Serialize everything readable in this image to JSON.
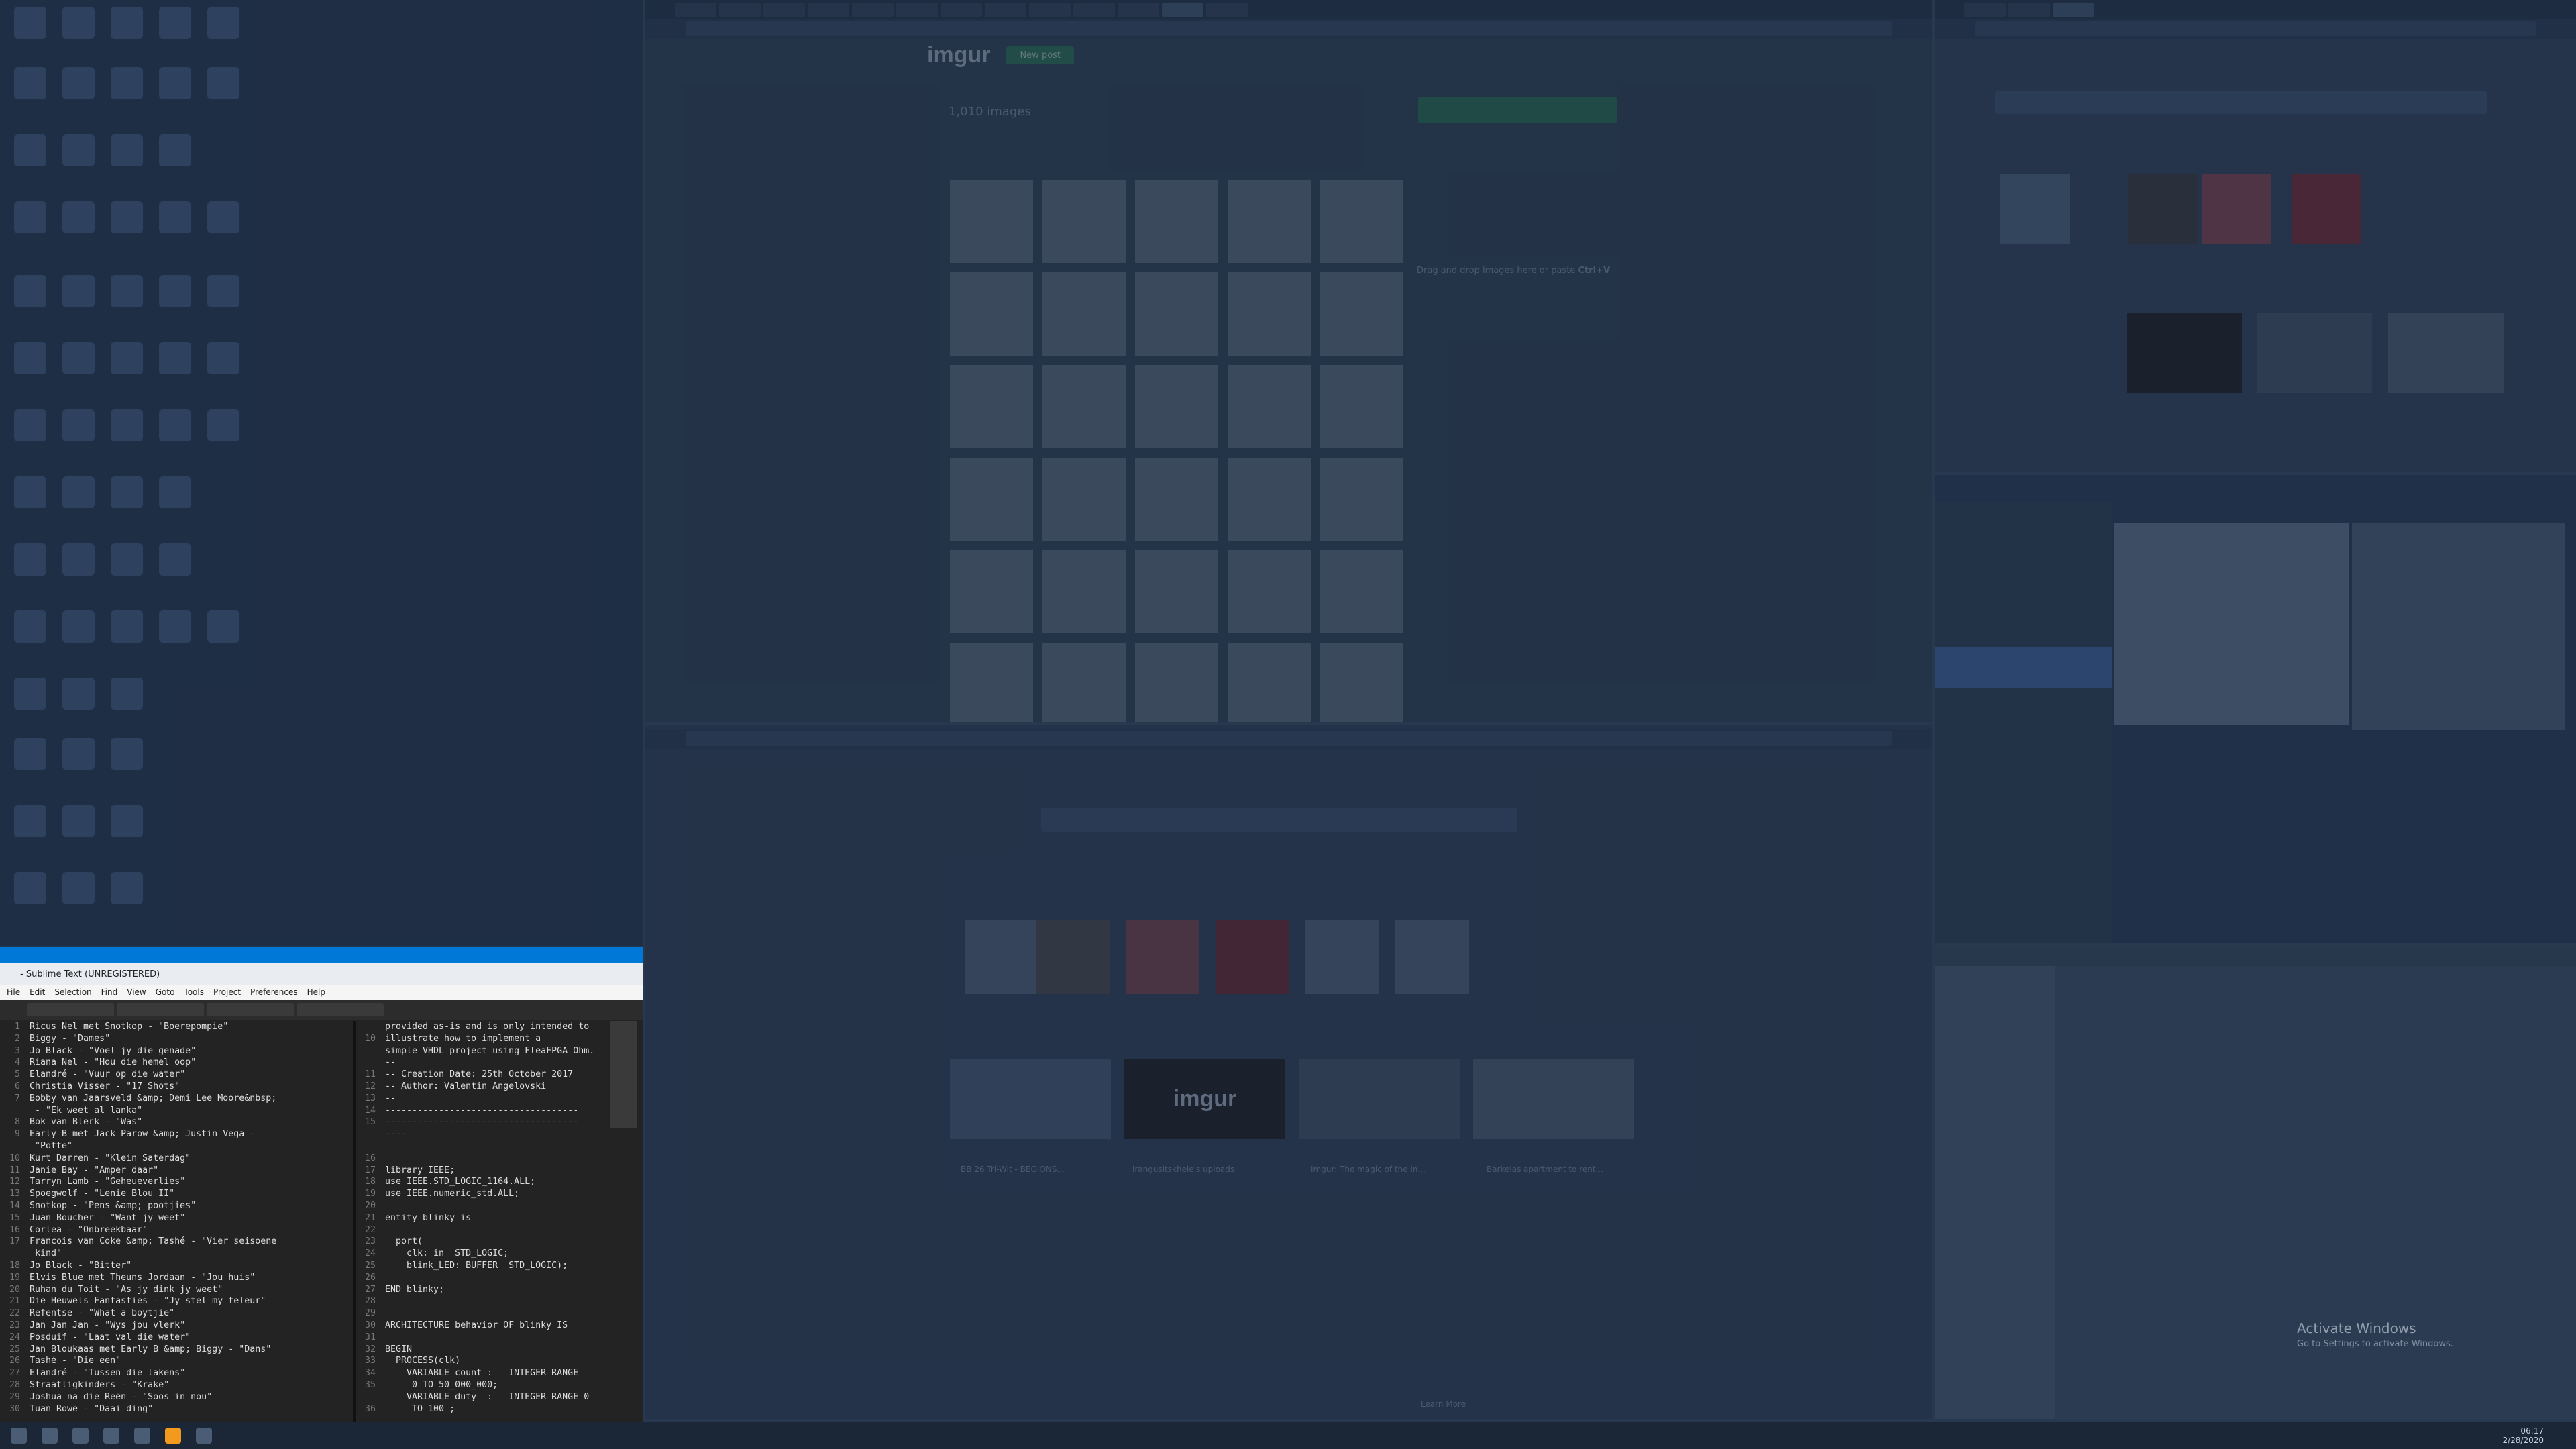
{
  "sublime": {
    "title": "- Sublime Text (UNREGISTERED)",
    "menu": [
      "File",
      "Edit",
      "Selection",
      "Find",
      "View",
      "Goto",
      "Tools",
      "Project",
      "Preferences",
      "Help"
    ],
    "left_lines": [
      "Ricus Nel met Snotkop - \"Boerepompie\"",
      "Biggy - \"Dames\"",
      "Jo Black - \"Voel jy die genade\"",
      "Riana Nel - \"Hou die hemel oop\"",
      "Elandré - \"Vuur op die water\"",
      "Christia Visser - \"17 Shots\"",
      "Bobby van Jaarsveld &amp; Demi Lee Moore&nbsp;",
      " - \"Ek weet al lanka\"",
      "Bok van Blerk - \"Was\"",
      "Early B met Jack Parow &amp; Justin Vega -",
      " \"Potte\"",
      "Kurt Darren - \"Klein Saterdag\"",
      "Janie Bay - \"Amper daar\"",
      "Tarryn Lamb - \"Geheueverlies\"",
      "Spoegwolf - \"Lenie Blou II\"",
      "Snotkop - \"Pens &amp; pootjies\"",
      "Juan Boucher - \"Want jy weet\"",
      "Corlea - \"Onbreekbaar\"",
      "Francois van Coke &amp; Tashé - \"Vier seisoene",
      " kind\"",
      "Jo Black - \"Bitter\"",
      "Elvis Blue met Theuns Jordaan - \"Jou huis\"",
      "Ruhan du Toit - \"As jy dink jy weet\"",
      "Die Heuwels Fantasties - \"Jy stel my teleur\"",
      "Refentse - \"What a boytjie\"",
      "Jan Jan Jan - \"Wys jou vlerk\"",
      "Posduif - \"Laat val die water\"",
      "Jan Bloukaas met Early B &amp; Biggy - \"Dans\"",
      "Tashé - \"Die een\"",
      "Elandré - \"Tussen die lakens\"",
      "Straatligkinders - \"Krake\"",
      "Joshua na die Reën - \"Soos in nou\"",
      "Tuan Rowe - \"Daai ding\""
    ],
    "right_lines": [
      "provided as-is and is only intended to",
      "illustrate how to implement a",
      "simple VHDL project using FleaFPGA Ohm.",
      "--",
      "-- Creation Date: 25th October 2017",
      "-- Author: Valentin Angelovski",
      "--",
      "------------------------------------",
      "------------------------------------",
      "----",
      "",
      "",
      "library IEEE;",
      "use IEEE.STD_LOGIC_1164.ALL;",
      "use IEEE.numeric_std.ALL;",
      "",
      "entity blinky is",
      "",
      "  port(",
      "    clk: in  STD_LOGIC;",
      "    blink_LED: BUFFER  STD_LOGIC);",
      "",
      "END blinky;",
      "",
      "",
      "ARCHITECTURE behavior OF blinky IS",
      "",
      "BEGIN",
      "  PROCESS(clk)",
      "    VARIABLE count :   INTEGER RANGE",
      "     0 TO 50_000_000;",
      "    VARIABLE duty  :   INTEGER RANGE 0",
      "     TO 100 ;"
    ],
    "right_numbers": [
      "",
      "10",
      "",
      "",
      "11",
      "12",
      "13",
      "14",
      "15",
      "",
      "",
      "16",
      "17",
      "18",
      "19",
      "20",
      "21",
      "22",
      "23",
      "24",
      "25",
      "26",
      "27",
      "28",
      "29",
      "30",
      "31",
      "32",
      "33",
      "34",
      "35",
      "",
      "36"
    ]
  },
  "imgur": {
    "logo": "imgur",
    "new_post": "New post",
    "count": "1,010 images",
    "hint": "Drag and drop images here or paste",
    "shortcut": "Ctrl+V"
  },
  "newtab": {
    "logo": "imgur",
    "captions": [
      "BB 26 Tri-Wit - BEGIONS...",
      "irangusitskhele's uploads",
      "Imgur: The magic of the in...",
      "Barkelas apartment to rent..."
    ],
    "learn": "Learn More"
  },
  "watermark": {
    "line1": "Activate Windows",
    "line2": "Go to Settings to activate Windows."
  },
  "tray": {
    "time": "06:17",
    "date": "2/28/2020"
  }
}
